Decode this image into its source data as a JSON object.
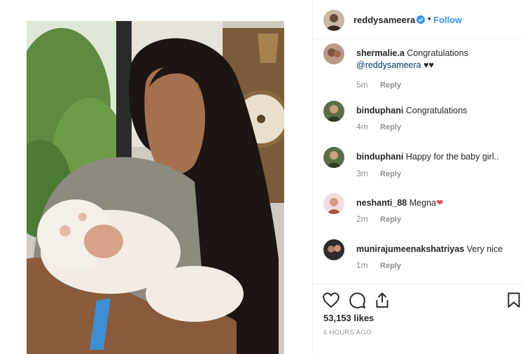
{
  "post": {
    "author": "reddysameera",
    "follow_label": "Follow",
    "separator": "•",
    "likes": "53,153 likes",
    "timestamp": "6 HOURS AGO"
  },
  "comments": [
    {
      "user": "shermalie.a",
      "text": "Congratulations",
      "mention": "@reddysameera",
      "suffix": " ♥♥",
      "age": "5m",
      "reply": "Reply"
    },
    {
      "user": "binduphani",
      "text": "Congratulations",
      "age": "4m",
      "reply": "Reply"
    },
    {
      "user": "binduphani",
      "text": "Happy for the baby girl..",
      "age": "3m",
      "reply": "Reply"
    },
    {
      "user": "neshanti_88",
      "text": "Megna",
      "suffix": "❤",
      "age": "2m",
      "reply": "Reply"
    },
    {
      "user": "munirajumeenakshatriyas",
      "text": "Very nice",
      "age": "1m",
      "reply": "Reply"
    }
  ],
  "icons": {
    "like": "heart-icon",
    "comment": "comment-icon",
    "share": "share-icon",
    "save": "bookmark-icon",
    "verified": "verified-badge-icon"
  },
  "colors": {
    "link": "#3897f0",
    "verified": "#3897f0",
    "muted": "#8e8e8e",
    "heart": "#ed4956"
  }
}
